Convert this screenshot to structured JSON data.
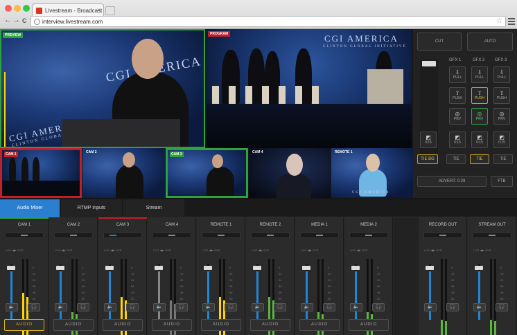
{
  "browser": {
    "tab_title": "Livestream - Broadcast &Wi",
    "tab_close": "×",
    "url": "interview.livestream.com",
    "nav_back": "←",
    "nav_forward": "→",
    "nav_reload": "C",
    "star": "☆"
  },
  "preview": {
    "preview_tag": "PREVIEW",
    "program_tag": "PROGRAM",
    "program_banner": "CGI AMERICA",
    "program_sub": "CLINTON GLOBAL INITIATIVE",
    "preview_banner": "CGI AMERICA",
    "preview_sub": "CLINTON GLOBAL INI",
    "podium_text": "CGI AMERICA"
  },
  "cameras": [
    {
      "label": "CAM 1",
      "badge": "1"
    },
    {
      "label": "CAM 2",
      "badge": "2"
    },
    {
      "label": "CAM 3",
      "badge": "3"
    },
    {
      "label": "CAM 4",
      "badge": "4"
    },
    {
      "label": "REMOTE 1",
      "badge": "5"
    },
    {
      "caption": "CGI AMERICA"
    }
  ],
  "controls": {
    "cut": "CUT",
    "auto": "AUTO",
    "gfx1": "GFX 1",
    "gfx2": "GFX 2",
    "gfx3": "GFX 3",
    "pull": "PULL",
    "push": "PUSH",
    "prv": "PRV",
    "dur1": "0:15",
    "dur2": "0:15",
    "dur3": "0:15",
    "dur4": "0:15",
    "tie_bg": "TIE BG",
    "tie": "TIE",
    "advert": "ADVERT: 0:29",
    "ftb": "FTB"
  },
  "tabs": [
    "Audio Mixer",
    "RTMP Inputs",
    "Stream"
  ],
  "mixer": {
    "mode_text": "LOG  ◀▶  OVR",
    "scale": [
      "0",
      "12",
      "24",
      "36",
      "48",
      "60"
    ],
    "speaker_icon": "🔈",
    "headphone_icon": "🎧",
    "audio_label": "AUDIO",
    "strips": [
      {
        "name": "CAM 1",
        "level": 0.55,
        "active": true
      },
      {
        "name": "CAM 2",
        "level": 0.3
      },
      {
        "name": "CAM 3",
        "level": 0.5
      },
      {
        "name": "CAM 4",
        "level": 0.45
      },
      {
        "name": "REMOTE 1",
        "level": 0.5
      },
      {
        "name": "REMOTE 2",
        "level": 0.5
      },
      {
        "name": "MEDIA 1",
        "level": 0.3
      },
      {
        "name": "MEDIA 2",
        "level": 0.3
      }
    ],
    "outputs": [
      {
        "name": "RECORD OUT",
        "level": 0.2
      },
      {
        "name": "STREAM OUT",
        "level": 0.2
      }
    ]
  },
  "colors": {
    "program_red": "#c0202a",
    "preview_green": "#2fa33b",
    "gfx_yellow": "#c4a21c",
    "meter_yellow": "#ffd400",
    "meter_green": "#5bb640",
    "fader_blue": "#1e87d8",
    "audio_active": "#d6b21d"
  }
}
